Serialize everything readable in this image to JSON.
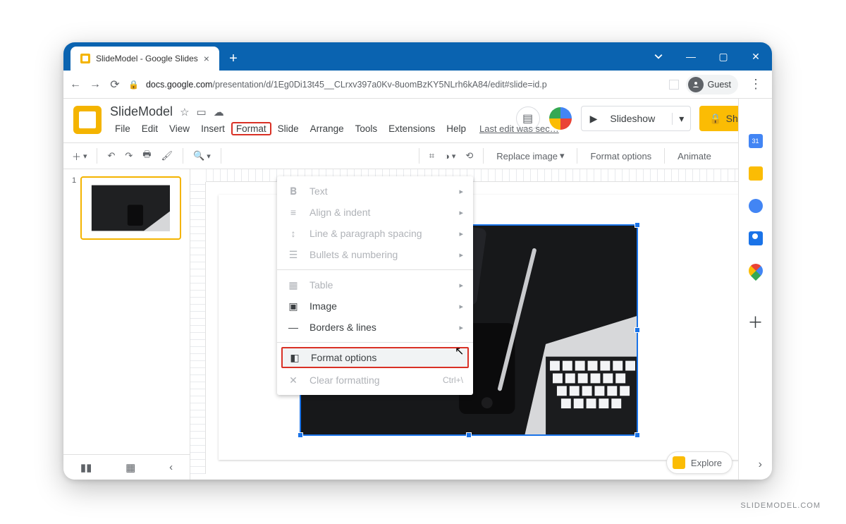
{
  "browser": {
    "tab_title": "SlideModel - Google Slides",
    "url_host": "docs.google.com",
    "url_path": "/presentation/d/1Eg0Di13t45__CLrxv397a0Kv-8uomBzKY5NLrh6kA84/edit#slide=id.p",
    "guest_label": "Guest"
  },
  "doc": {
    "title": "SlideModel",
    "last_edit": "Last edit was sec…"
  },
  "menus": {
    "file": "File",
    "edit": "Edit",
    "view": "View",
    "insert": "Insert",
    "format": "Format",
    "slide": "Slide",
    "arrange": "Arrange",
    "tools": "Tools",
    "extensions": "Extensions",
    "help": "Help"
  },
  "header_buttons": {
    "slideshow": "Slideshow",
    "share": "Share"
  },
  "toolbar": {
    "replace_image": "Replace image",
    "format_options": "Format options",
    "animate": "Animate"
  },
  "dropdown": {
    "text": "Text",
    "align": "Align & indent",
    "line": "Line & paragraph spacing",
    "bullets": "Bullets & numbering",
    "table": "Table",
    "image": "Image",
    "borders": "Borders & lines",
    "format_options": "Format options",
    "clear": "Clear formatting",
    "clear_sc": "Ctrl+\\"
  },
  "thumb": {
    "index": "1"
  },
  "footer": {
    "explore": "Explore"
  },
  "watermark": "SLIDEMODEL.COM"
}
